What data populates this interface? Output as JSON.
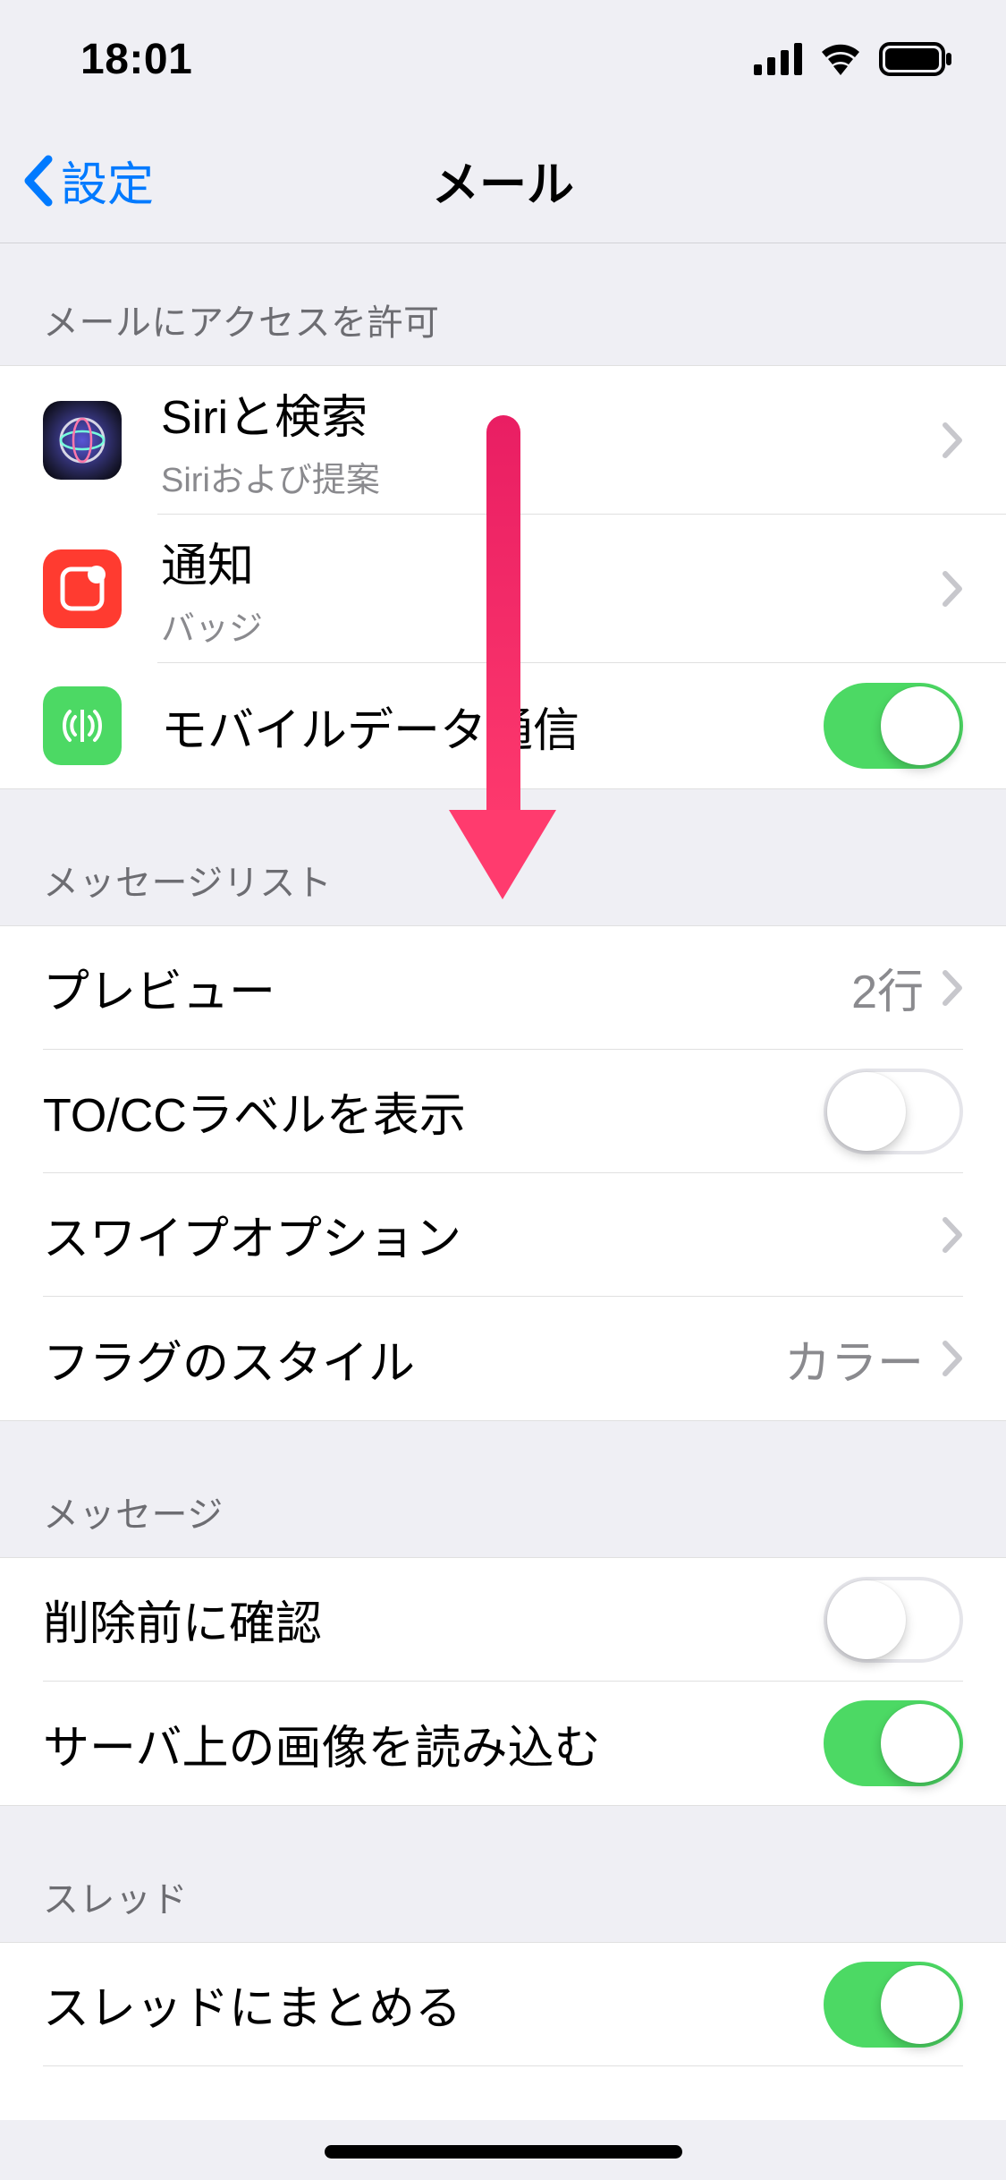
{
  "statusbar": {
    "time": "18:01"
  },
  "nav": {
    "back_label": "設定",
    "title": "メール"
  },
  "sections": {
    "access": {
      "header": "メールにアクセスを許可",
      "siri": {
        "title": "Siriと検索",
        "sub": "Siriおよび提案"
      },
      "notifications": {
        "title": "通知",
        "sub": "バッジ"
      },
      "cellular": {
        "title": "モバイルデータ通信",
        "on": true
      }
    },
    "message_list": {
      "header": "メッセージリスト",
      "preview": {
        "title": "プレビュー",
        "detail": "2行"
      },
      "tocc": {
        "title": "TO/CCラベルを表示",
        "on": false
      },
      "swipe": {
        "title": "スワイプオプション"
      },
      "flag_style": {
        "title": "フラグのスタイル",
        "detail": "カラー"
      }
    },
    "message": {
      "header": "メッセージ",
      "confirm_delete": {
        "title": "削除前に確認",
        "on": false
      },
      "load_images": {
        "title": "サーバ上の画像を読み込む",
        "on": true
      }
    },
    "thread": {
      "header": "スレッド",
      "group": {
        "title": "スレッドにまとめる",
        "on": true
      }
    }
  },
  "colors": {
    "accent": "#007aff",
    "green": "#4cd964"
  }
}
